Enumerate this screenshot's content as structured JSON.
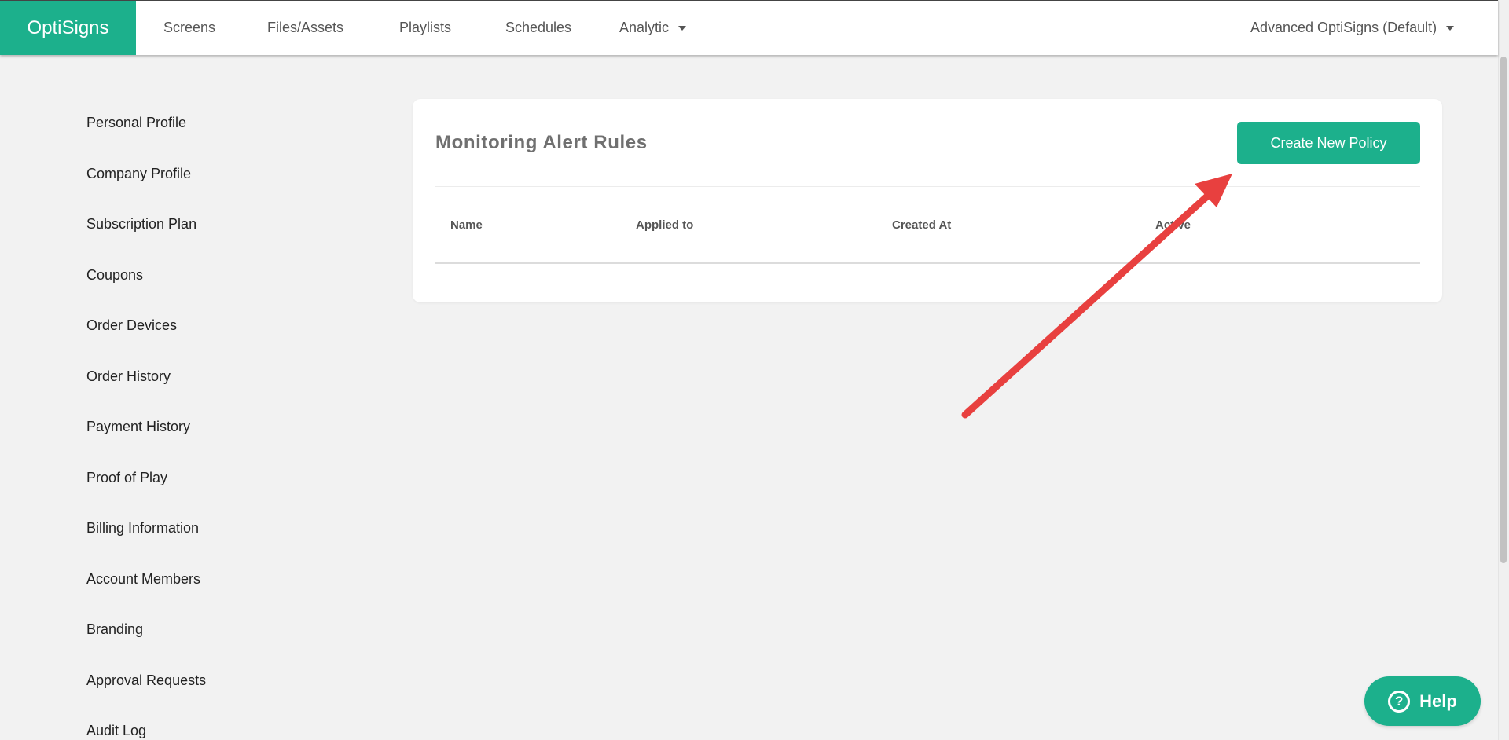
{
  "app": {
    "logo": "OptiSigns",
    "nav": [
      "Screens",
      "Files/Assets",
      "Playlists",
      "Schedules",
      "Analytic"
    ],
    "account": "Advanced OptiSigns (Default)",
    "brand_color": "#1cb08c"
  },
  "sidebar": {
    "items": [
      "Personal Profile",
      "Company Profile",
      "Subscription Plan",
      "Coupons",
      "Order Devices",
      "Order History",
      "Payment History",
      "Proof of Play",
      "Billing Information",
      "Account Members",
      "Branding",
      "Approval Requests",
      "Audit Log"
    ]
  },
  "main": {
    "title": "Monitoring Alert Rules",
    "create_button": "Create New Policy",
    "columns": [
      "Name",
      "Applied to",
      "Created At",
      "Active"
    ]
  },
  "help": {
    "icon": "question-circle-icon",
    "label": "Help"
  },
  "annotation": {
    "arrow_color": "#e8403f"
  }
}
